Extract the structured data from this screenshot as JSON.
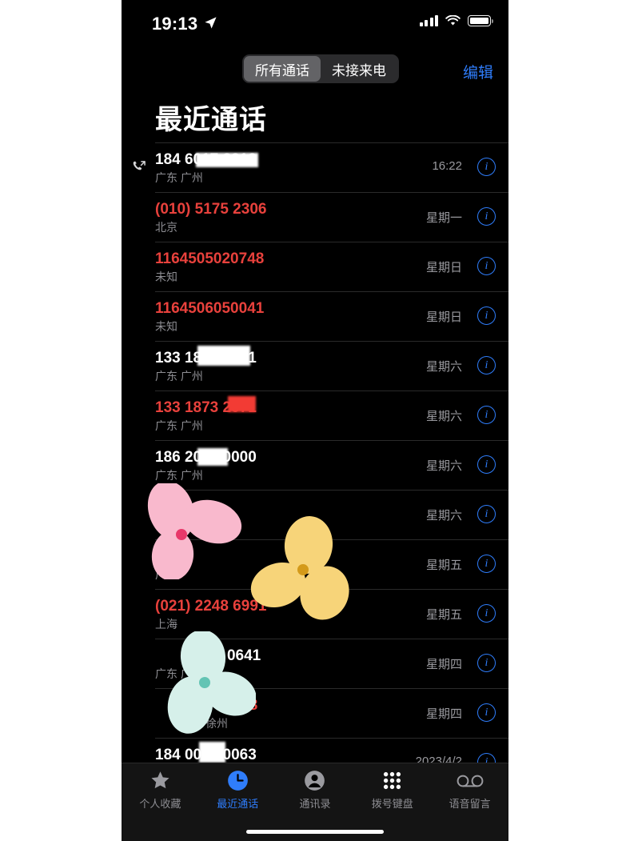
{
  "status_bar": {
    "time": "19:13",
    "location_icon": "location-arrow-icon",
    "signal_icon": "cellular-signal-icon",
    "wifi_icon": "wifi-icon",
    "battery_icon": "battery-icon"
  },
  "nav": {
    "segments": [
      {
        "label": "所有通话",
        "active": true
      },
      {
        "label": "未接来电",
        "active": false
      }
    ],
    "edit_label": "编辑",
    "accent_color": "#2f7dfb"
  },
  "page_title": "最近通话",
  "colors": {
    "missed_red": "#e8413c",
    "accent_blue": "#2f7dfb",
    "secondary_text": "#8d8d92",
    "background": "#000000"
  },
  "call_list": [
    {
      "number": "184 6017 2212",
      "location": "广东 广州",
      "when": "16:22",
      "missed": false,
      "call_icon": "outgoing-call-icon",
      "redacted": true
    },
    {
      "number": "(010) 5175 2306",
      "location": "北京",
      "when": "星期一",
      "missed": true,
      "call_icon": "",
      "redacted": false
    },
    {
      "number": "1164505020748",
      "location": "未知",
      "when": "星期日",
      "missed": true,
      "call_icon": "",
      "redacted": false
    },
    {
      "number": "1164506050041",
      "location": "未知",
      "when": "星期日",
      "missed": true,
      "call_icon": "",
      "redacted": false
    },
    {
      "number": "133 1873 2071",
      "location": "广东 广州",
      "when": "星期六",
      "missed": false,
      "call_icon": "",
      "redacted": true
    },
    {
      "number": "133 1873 2071",
      "location": "广东 广州",
      "when": "星期六",
      "missed": true,
      "call_icon": "",
      "redacted": true
    },
    {
      "number": "186 2000 0000",
      "location": "广东 广州",
      "when": "星期六",
      "missed": false,
      "call_icon": "",
      "redacted": true
    },
    {
      "number": "",
      "location": "",
      "when": "星期六",
      "missed": false,
      "call_icon": "",
      "redacted": false
    },
    {
      "number": "",
      "location": "广州",
      "when": "星期五",
      "missed": false,
      "call_icon": "",
      "redacted": false
    },
    {
      "number": "(021) 2248 6991",
      "location": "上海",
      "when": "星期五",
      "missed": true,
      "call_icon": "",
      "redacted": false
    },
    {
      "number": "251 0641",
      "location": "广东 广州",
      "when": "星期四",
      "missed": false,
      "call_icon": "",
      "redacted": false
    },
    {
      "number": "8348",
      "location": "徐州",
      "when": "星期四",
      "missed": true,
      "call_icon": "",
      "redacted": false
    },
    {
      "number": "184 0010 0063",
      "location": "",
      "when": "2023/4/2",
      "missed": false,
      "call_icon": "",
      "redacted": true
    }
  ],
  "tab_bar": {
    "items": [
      {
        "label": "个人收藏",
        "icon": "star-icon",
        "active": false
      },
      {
        "label": "最近通话",
        "icon": "clock-icon",
        "active": true
      },
      {
        "label": "通讯录",
        "icon": "person-circle-icon",
        "active": false
      },
      {
        "label": "拨号键盘",
        "icon": "keypad-icon",
        "active": false
      },
      {
        "label": "语音留言",
        "icon": "voicemail-icon",
        "active": false
      }
    ]
  },
  "stickers": [
    {
      "name": "pink-flower-sticker",
      "color": "#f9b9cd",
      "center_color": "#e8386a"
    },
    {
      "name": "yellow-flower-sticker",
      "color": "#f7d479",
      "center_color": "#d49a1a"
    },
    {
      "name": "mint-flower-sticker",
      "color": "#d6f0ea",
      "center_color": "#63c4b4"
    }
  ]
}
